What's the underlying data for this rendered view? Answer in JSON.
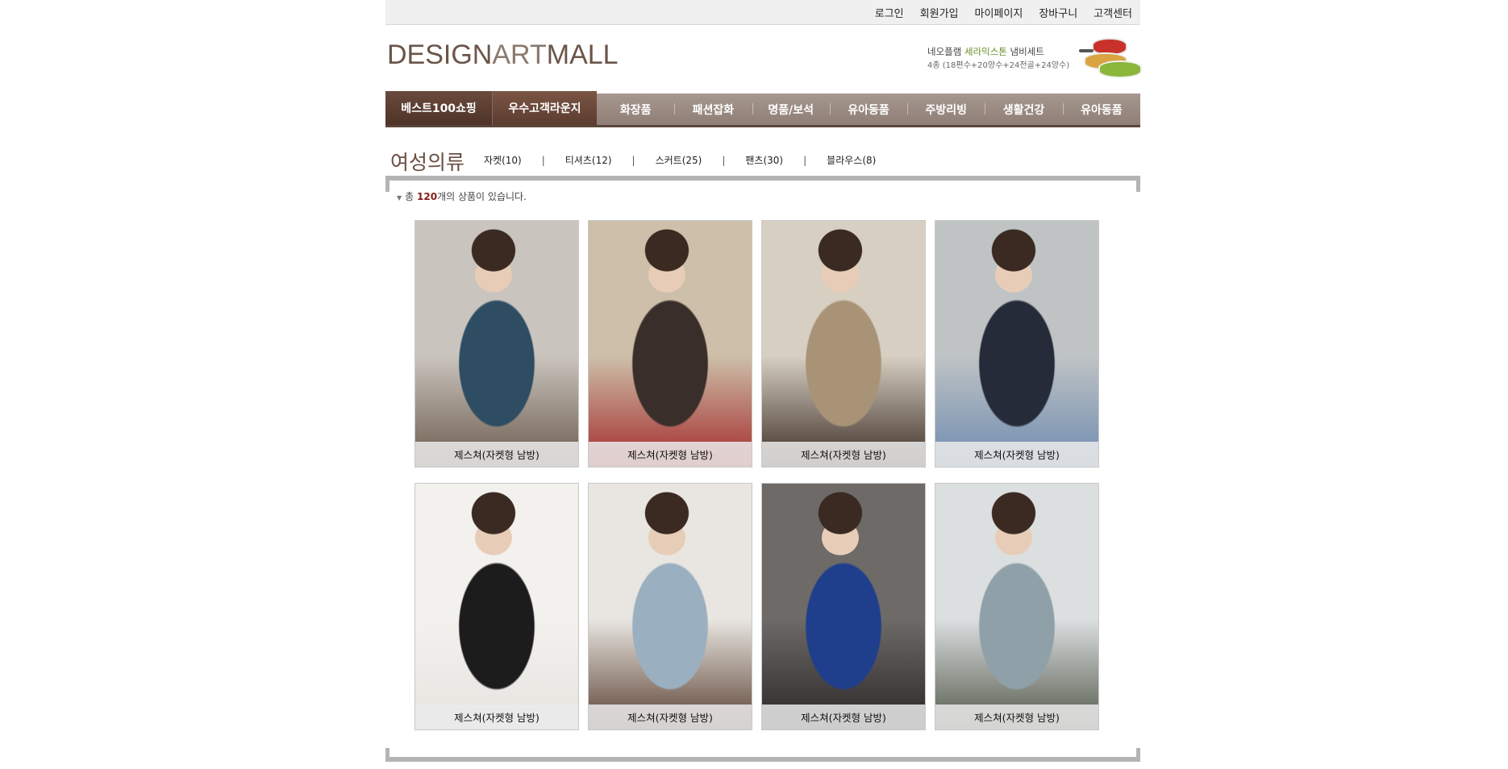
{
  "top_links": [
    "로그인",
    "회원가입",
    "마이페이지",
    "장바구니",
    "고객센터"
  ],
  "logo": {
    "part1": "DESIGN",
    "part2": "ART",
    "part3": "MALL"
  },
  "promo": {
    "line1_pre": "네오플램 ",
    "line1_hl": "세라믹스톤",
    "line1_post": " 냄비세트",
    "line2": "4종 (18편수+20양수+24전골+24양수)"
  },
  "nav": {
    "lead": [
      "베스트100쇼핑",
      "우수고객라운지"
    ],
    "items": [
      "화장품",
      "패션잡화",
      "명품/보석",
      "유아동품",
      "주방리빙",
      "생활건강",
      "유아동품"
    ]
  },
  "category": {
    "title": "여성의류",
    "subcats": [
      "자켓(10)",
      "티셔츠(12)",
      "스커트(25)",
      "팬츠(30)",
      "블라우스(8)"
    ],
    "separator": "|"
  },
  "count": {
    "pre": "총 ",
    "num": "120",
    "post": "개의 상품이 있습니다."
  },
  "products": [
    {
      "name": "제스쳐(자켓형 남방)",
      "colors": [
        "#c9c4bd",
        "#2e4d63",
        "#6b5a4c"
      ]
    },
    {
      "name": "제스쳐(자켓형 남방)",
      "colors": [
        "#cdbfa9",
        "#3a2e2a",
        "#a32a2a"
      ]
    },
    {
      "name": "제스쳐(자켓형 남방)",
      "colors": [
        "#d7cfc2",
        "#a89376",
        "#3b2c25"
      ]
    },
    {
      "name": "제스쳐(자켓형 남방)",
      "colors": [
        "#bfc3c4",
        "#262b3a",
        "#6e8bb0"
      ]
    },
    {
      "name": "제스쳐(자켓형 남방)",
      "colors": [
        "#f3f1ee",
        "#1c1c1c",
        "#e6e3df"
      ]
    },
    {
      "name": "제스쳐(자켓형 남방)",
      "colors": [
        "#e9e6e1",
        "#9aafc0",
        "#5a4032"
      ]
    },
    {
      "name": "제스쳐(자켓형 남방)",
      "colors": [
        "#6d6a68",
        "#1f3f8c",
        "#2a2626"
      ]
    },
    {
      "name": "제스쳐(자켓형 남방)",
      "colors": [
        "#dcdfe0",
        "#8fa0a8",
        "#53584a"
      ]
    }
  ]
}
